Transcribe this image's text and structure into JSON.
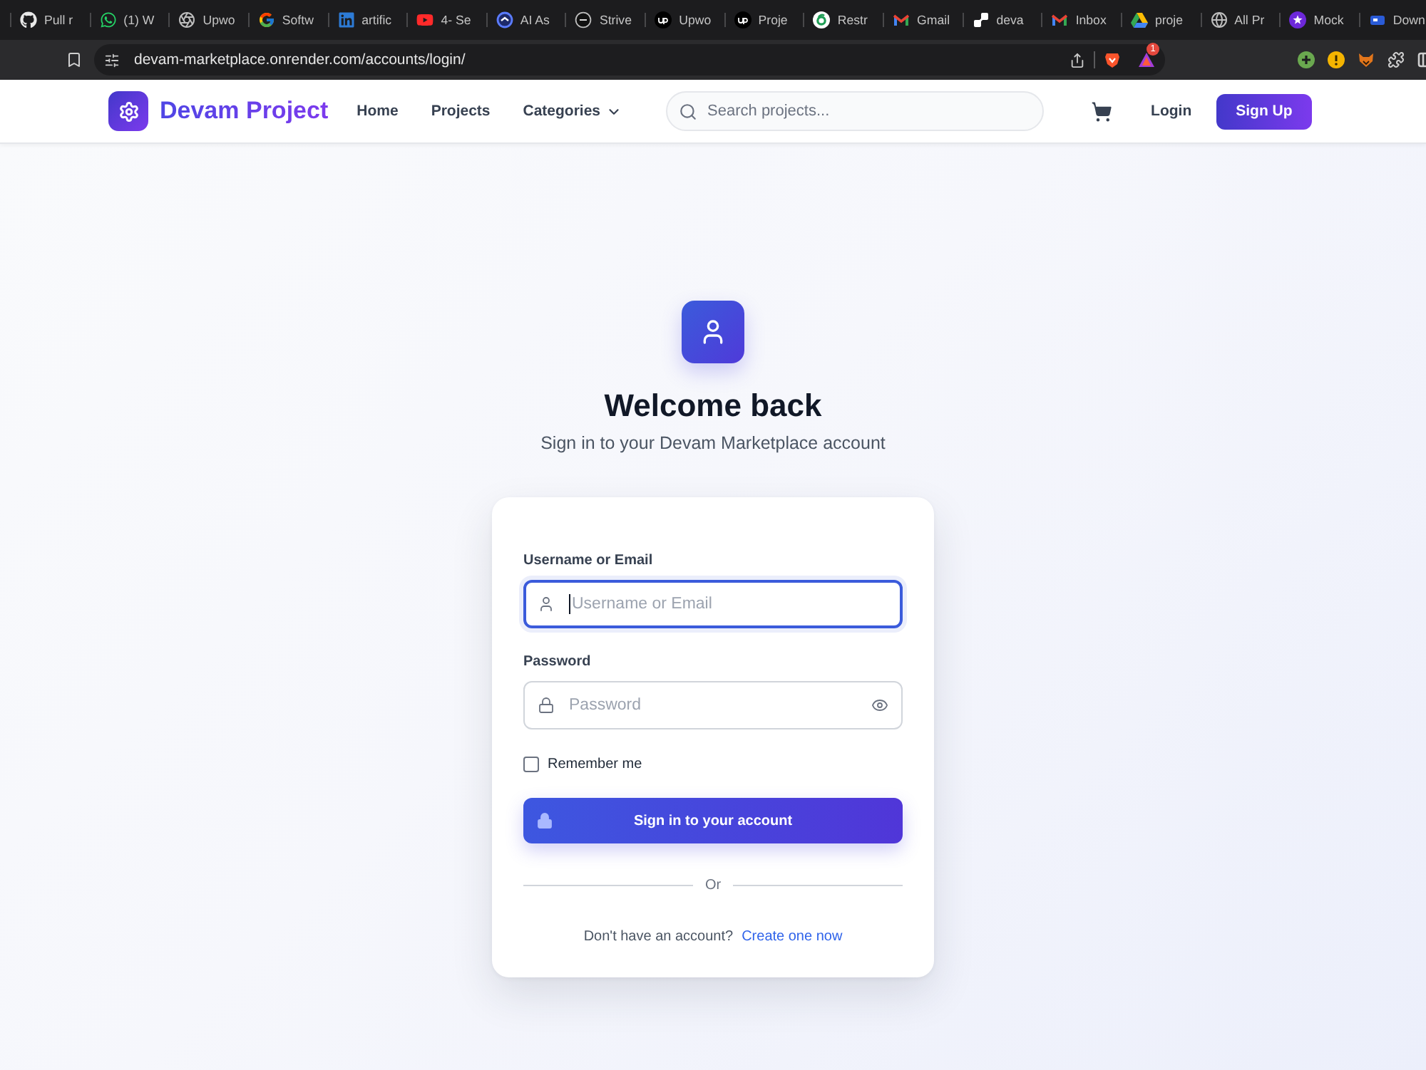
{
  "browser": {
    "tabs": [
      {
        "label": "Pull r",
        "kind": "github",
        "selected": false
      },
      {
        "label": "(1) W",
        "kind": "whatsapp",
        "selected": false
      },
      {
        "label": "Upwo",
        "kind": "openai",
        "selected": false
      },
      {
        "label": "Softw",
        "kind": "google",
        "selected": false
      },
      {
        "label": "artific",
        "kind": "linkedin",
        "selected": false
      },
      {
        "label": "4- Se",
        "kind": "youtube",
        "selected": false
      },
      {
        "label": "AI As",
        "kind": "ring",
        "selected": false
      },
      {
        "label": "Strive",
        "kind": "dark-ring",
        "selected": false
      },
      {
        "label": "Upwo",
        "kind": "disc",
        "selected": false
      },
      {
        "label": "Proje",
        "kind": "disc",
        "selected": false
      },
      {
        "label": "Restr",
        "kind": "green-ring",
        "selected": false
      },
      {
        "label": "Gmail",
        "kind": "gmail",
        "selected": false
      },
      {
        "label": "deva",
        "kind": "blocks",
        "selected": false
      },
      {
        "label": "Inbox",
        "kind": "gmail",
        "selected": false
      },
      {
        "label": "proje",
        "kind": "drive",
        "selected": false
      },
      {
        "label": "All Pr",
        "kind": "globe",
        "selected": false
      },
      {
        "label": "Mock",
        "kind": "star",
        "selected": false
      },
      {
        "label": "Down",
        "kind": "rect",
        "selected": false
      }
    ],
    "address_bar": {
      "url": "devam-marketplace.onrender.com/accounts/login/"
    },
    "rewards_badge": "1"
  },
  "navbar": {
    "brand": "Devam Project",
    "links": [
      {
        "label": "Home",
        "kind": "link"
      },
      {
        "label": "Projects",
        "kind": "link"
      },
      {
        "label": "Categories",
        "kind": "dropdown"
      }
    ],
    "search": {
      "placeholder": "Search projects..."
    },
    "login": "Login",
    "signup": "Sign Up"
  },
  "login": {
    "title": "Welcome back",
    "subtitle": "Sign in to your Devam Marketplace account",
    "fields": [
      {
        "label": "Username or Email",
        "placeholder": "Username or Email",
        "kind": "user",
        "focused": true
      },
      {
        "label": "Password",
        "placeholder": "Password",
        "kind": "password",
        "focused": false
      }
    ],
    "remember": {
      "label": "Remember me",
      "checked": false
    },
    "submit": "Sign in to your account",
    "divider": "Or",
    "footer": {
      "text": "Don't have an account?",
      "link": "Create one now"
    }
  }
}
